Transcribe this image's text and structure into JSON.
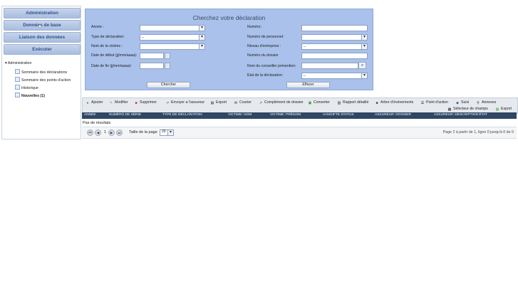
{
  "sidebar": {
    "buttons": [
      "Administration",
      "Données de base",
      "Liaison des données",
      "Exécuter"
    ],
    "tree_root": "Administration",
    "tree_items": [
      "Sommaire des déclarations",
      "Sommaire des points d'action",
      "Historique",
      "Nouvelles (1)"
    ]
  },
  "search": {
    "title": "Cherchez votre déclaration",
    "labels": {
      "annee": "Année :",
      "type": "Type de déclaration:",
      "victime": "Nom de la victime :",
      "debut": "Date de début (jj/mm/aaaa):",
      "fin": "Date de fin (jj/mm/aaaa):",
      "numero": "Numéro:",
      "personnel": "Numéro de personnel:",
      "niveau": "Niveau d'entreprise :",
      "dossier": "Numéro du dossier",
      "conseiller": "Nom du conseiller prévention:",
      "etat": "Etat de la déclaration:"
    },
    "dd_values": {
      "type": "_",
      "niveau": "_",
      "etat": "_"
    },
    "buttons": {
      "chercher": "Chercher",
      "effacer": "Effacer"
    }
  },
  "toolbar": {
    "row1": [
      "Ajouter",
      "Modifier",
      "Supprimer",
      "Envoyer a l'assureur",
      "Export",
      "Courier",
      "Complément de dossier",
      "Converter",
      "Rapport détaillé",
      "Arbre d'événements",
      "Point d'action",
      "Suivi",
      "Annexes"
    ],
    "row2": [
      "Sélecteur de champs",
      "Export"
    ]
  },
  "table": {
    "headers": [
      "ANNÉE",
      "NUMÉRO DE SÉRIE",
      "TYPE DE DÉCLARATION",
      "VICTIME: NOM",
      "VICTIME: PRÉNOM",
      "AANGIFTE STATUS",
      "ASSUREUR: DOSSIER",
      "ASSUREUR: DESCRIPTION ÉTAT"
    ],
    "empty": "Pas de résultats"
  },
  "pager": {
    "current_page": "1",
    "page_size_label": "Taille de la page",
    "page_size": "20",
    "info": "Page 2 à partir de 1, ligne 0 jusqu'à 0 de 0"
  }
}
